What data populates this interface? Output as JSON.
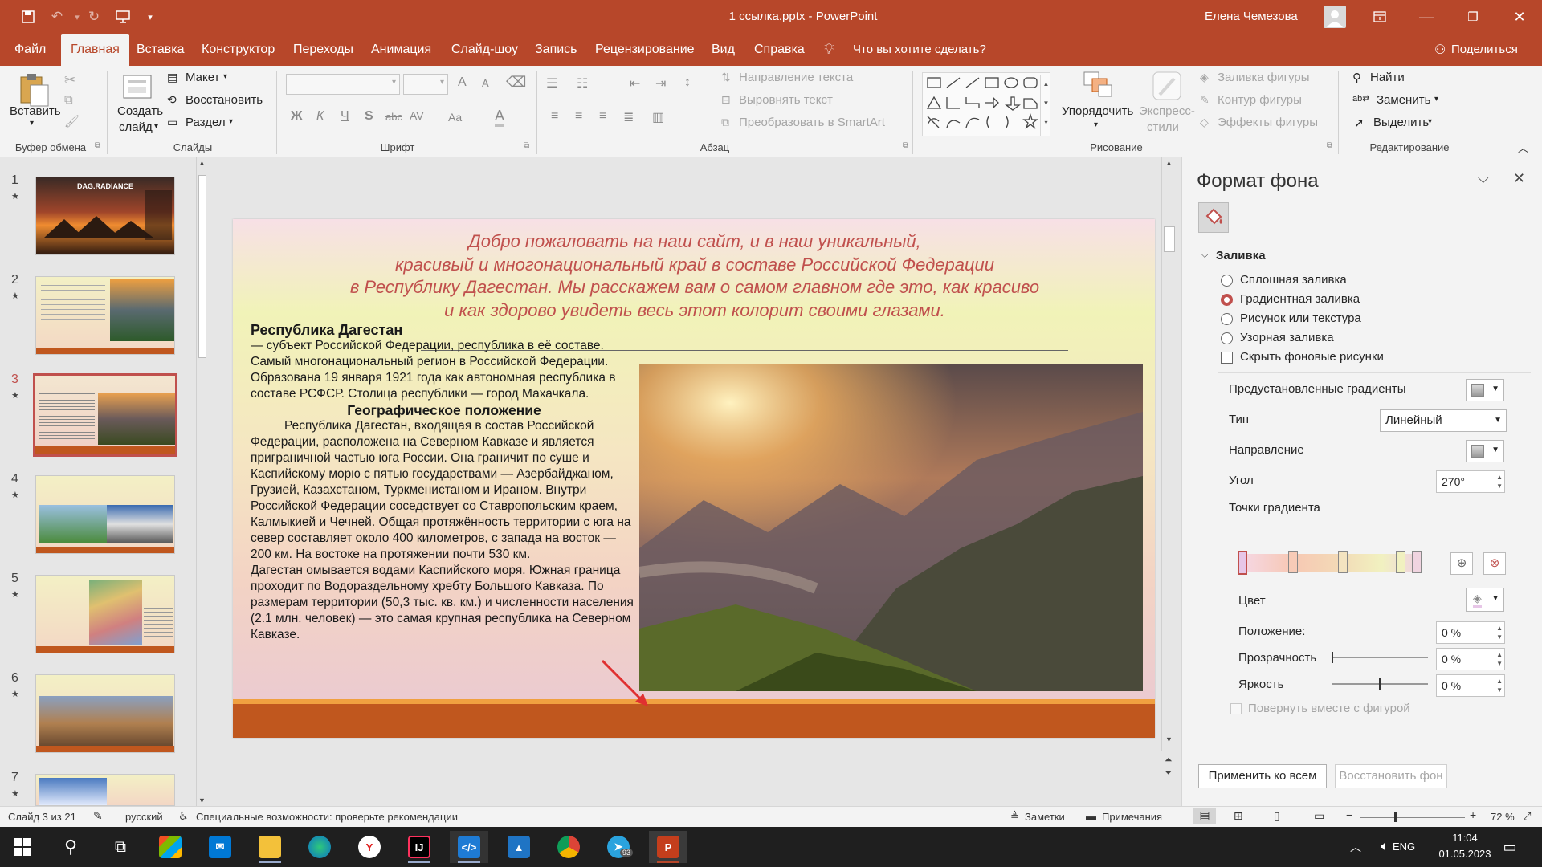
{
  "titlebar": {
    "doc_title": "1 ссылка.pptx  -  PowerPoint",
    "user_name": "Елена Чемезова"
  },
  "tabs": [
    "Файл",
    "Главная",
    "Вставка",
    "Конструктор",
    "Переходы",
    "Анимация",
    "Слайд-шоу",
    "Запись",
    "Рецензирование",
    "Вид",
    "Справка"
  ],
  "tell_me": "Что вы хотите сделать?",
  "share": "Поделиться",
  "ribbon": {
    "clipboard": {
      "paste": "Вставить",
      "label": "Буфер обмена"
    },
    "slides": {
      "new_slide_1": "Создать",
      "new_slide_2": "слайд",
      "layout": "Макет",
      "reset": "Восстановить",
      "section": "Раздел",
      "label": "Слайды"
    },
    "font": {
      "label": "Шрифт",
      "bold": "Ж",
      "italic": "К",
      "underline": "Ч",
      "shadow": "S",
      "strike": "abc",
      "spacing": "AV",
      "case": "Aa",
      "color": "A",
      "grow": "A",
      "shrink": "A"
    },
    "paragraph": {
      "text_direction": "Направление текста",
      "align_text": "Выровнять текст",
      "smartart": "Преобразовать в SmartArt",
      "label": "Абзац"
    },
    "drawing": {
      "arrange": "Упорядочить",
      "quick_styles_1": "Экспресс-",
      "quick_styles_2": "стили",
      "shape_fill": "Заливка фигуры",
      "shape_outline": "Контур фигуры",
      "shape_effects": "Эффекты фигуры",
      "label": "Рисование"
    },
    "editing": {
      "find": "Найти",
      "replace": "Заменить",
      "select": "Выделить",
      "label": "Редактирование"
    }
  },
  "thumbnails": [
    {
      "num": "1",
      "star": "★"
    },
    {
      "num": "2",
      "star": "★"
    },
    {
      "num": "3",
      "star": "★"
    },
    {
      "num": "4",
      "star": "★"
    },
    {
      "num": "5",
      "star": "★"
    },
    {
      "num": "6",
      "star": "★"
    },
    {
      "num": "7",
      "star": "★"
    }
  ],
  "thumb1_title": "DAG.RADIANCE",
  "slide": {
    "heading_lines": [
      "Добро пожаловать на наш сайт, и в наш уникальный,",
      "красивый и многонациональный край в составе Российской Федерации",
      "в Республику Дагестан. Мы расскажем вам о самом главном где это, как красиво",
      "и как здорово увидеть весь этот колорит своими глазами."
    ],
    "subtitle": "Республика Дагестан",
    "para1": " — субъект Российской Федерации, республика в её составе. Самый многонациональный регион в Российской Федерации.",
    "para2": "Образована 19 января 1921 года как автономная республика в составе РСФСР. Столица республики — город Махачкала.",
    "geo_heading": "Географическое положение",
    "geo_text": "Республика Дагестан, входящая в состав Российской Федерации, расположена на Северном Кавказе и является приграничной частью юга России. Она граничит по суше и Каспийскому морю с пятью государствами — Азербайджаном, Грузией, Казахстаном, Туркменистаном и Ираном. Внутри Российской Федерации соседствует со Ставропольским краем, Калмыкией и Чечней. Общая протяжённость территории с юга на север составляет около 400 километров, с запада на восток — 200 км. На востоке на протяжении почти 530 км.",
    "sea_text": "Дагестан омывается водами Каспийского моря. Южная граница проходит по Водораздельному хребту Большого Кавказа. По размерам территории (50,3 тыс. кв. км.) и численности населения (2.1 млн. человек) — это самая крупная республика на Северном Кавказе."
  },
  "format_pane": {
    "title": "Формат фона",
    "section": "Заливка",
    "options": [
      "Сплошная заливка",
      "Градиентная заливка",
      "Рисунок или текстура",
      "Узорная заливка"
    ],
    "selected_option": "Градиентная заливка",
    "hide_bg": "Скрыть фоновые рисунки",
    "preset": "Предустановленные градиенты",
    "type_label": "Тип",
    "type_value": "Линейный",
    "direction": "Направление",
    "angle_label": "Угол",
    "angle_value": "270°",
    "stops_label": "Точки градиента",
    "color_label": "Цвет",
    "position_label": "Положение:",
    "position_value": "0 %",
    "transparency_label": "Прозрачность",
    "transparency_value": "0 %",
    "brightness_label": "Яркость",
    "brightness_value": "0 %",
    "rotate_label": "Повернуть вместе с фигурой",
    "apply_all": "Применить ко всем",
    "reset_bg": "Восстановить фон"
  },
  "status": {
    "slide_of": "Слайд 3 из 21",
    "language": "русский",
    "accessibility": "Специальные возможности: проверьте рекомендации",
    "notes": "Заметки",
    "comments": "Примечания",
    "zoom": "72 %"
  },
  "taskbar": {
    "time": "11:04",
    "date": "01.05.2023",
    "lang": "ENG",
    "telegram_badge": "93"
  },
  "colors": {
    "accent": "#b7472a",
    "slide_title": "#c0504d",
    "slide_band": "#c0571e"
  }
}
